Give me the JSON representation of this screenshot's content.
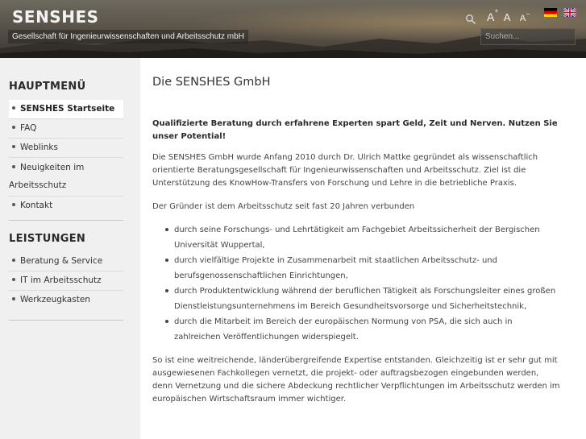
{
  "header": {
    "site_title": "SENSHES",
    "slogan": "Gesellschaft für Ingenieurwissenschaften und Arbeitsschutz mbH",
    "font_size_controls": [
      "A",
      "A",
      "A"
    ],
    "search_placeholder": "Suchen...",
    "languages": [
      "Deutsch",
      "English"
    ]
  },
  "sidebar": {
    "main_menu_title": "HAUPTMENÜ",
    "main_menu_items": [
      {
        "label": "SENSHES Startseite",
        "active": true
      },
      {
        "label": "FAQ"
      },
      {
        "label": "Weblinks"
      },
      {
        "label_line1": "Neuigkeiten im",
        "label_line2": "Arbeitsschutz"
      },
      {
        "label": "Kontakt"
      }
    ],
    "services_title": "LEISTUNGEN",
    "services_items": [
      {
        "label": "Beratung & Service"
      },
      {
        "label": "IT im Arbeitsschutz"
      },
      {
        "label": "Werkzeugkasten"
      }
    ]
  },
  "content": {
    "title": "Die SENSHES GmbH",
    "intro": "Qualifizierte Beratung durch erfahrene Experten spart  Geld, Zeit und Nerven. Nutzen Sie unser Potential!",
    "paragraph1": "Die SENSHES GmbH wurde Anfang 2010 durch Dr. Ulrich Mattke gegründet als wissenschaftlich orientierte Beratungsgesellschaft für Ingenieurwissenschaften und Arbeitsschutz. Ziel ist die Unterstützung des KnowHow-Transfers von Forschung und Lehre in die betriebliche Praxis.",
    "paragraph2": "Der Gründer ist dem Arbeitsschutz seit fast 20 Jahren verbunden",
    "list_items": [
      "durch seine Forschungs- und Lehrtätigkeit am Fachgebiet Arbeitssicherheit der Bergischen Universität Wuppertal,",
      "durch vielfältige Projekte in Zusammenarbeit mit staatlichen Arbeitsschutz- und berufsgenossenschaftlichen Einrichtungen,",
      "durch Produktentwicklung während der beruflichen Tätigkeit als Forschungsleiter eines großen Dienstleistungsunternehmens im Bereich Gesundheitsvorsorge und Sicherheitstechnik,",
      "durch die Mitarbeit im Bereich der europäischen Normung von PSA, die sich auch in zahlreichen Veröffentlichungen widerspiegelt."
    ],
    "paragraph3": "So ist eine weitreichende, länderübergreifende Expertise entstanden. Gleichzeitig ist er sehr gut mit ausgewiesenen Fachkollegen vernetzt, die projekt- oder auftragsbezogen eingebunden werden, denn Vernetzung und die sichere Abdeckung rechtlicher Verpflichtungen im Arbeitsschutz werden im europäischen Wirtschaftsraum immer wichtiger."
  }
}
